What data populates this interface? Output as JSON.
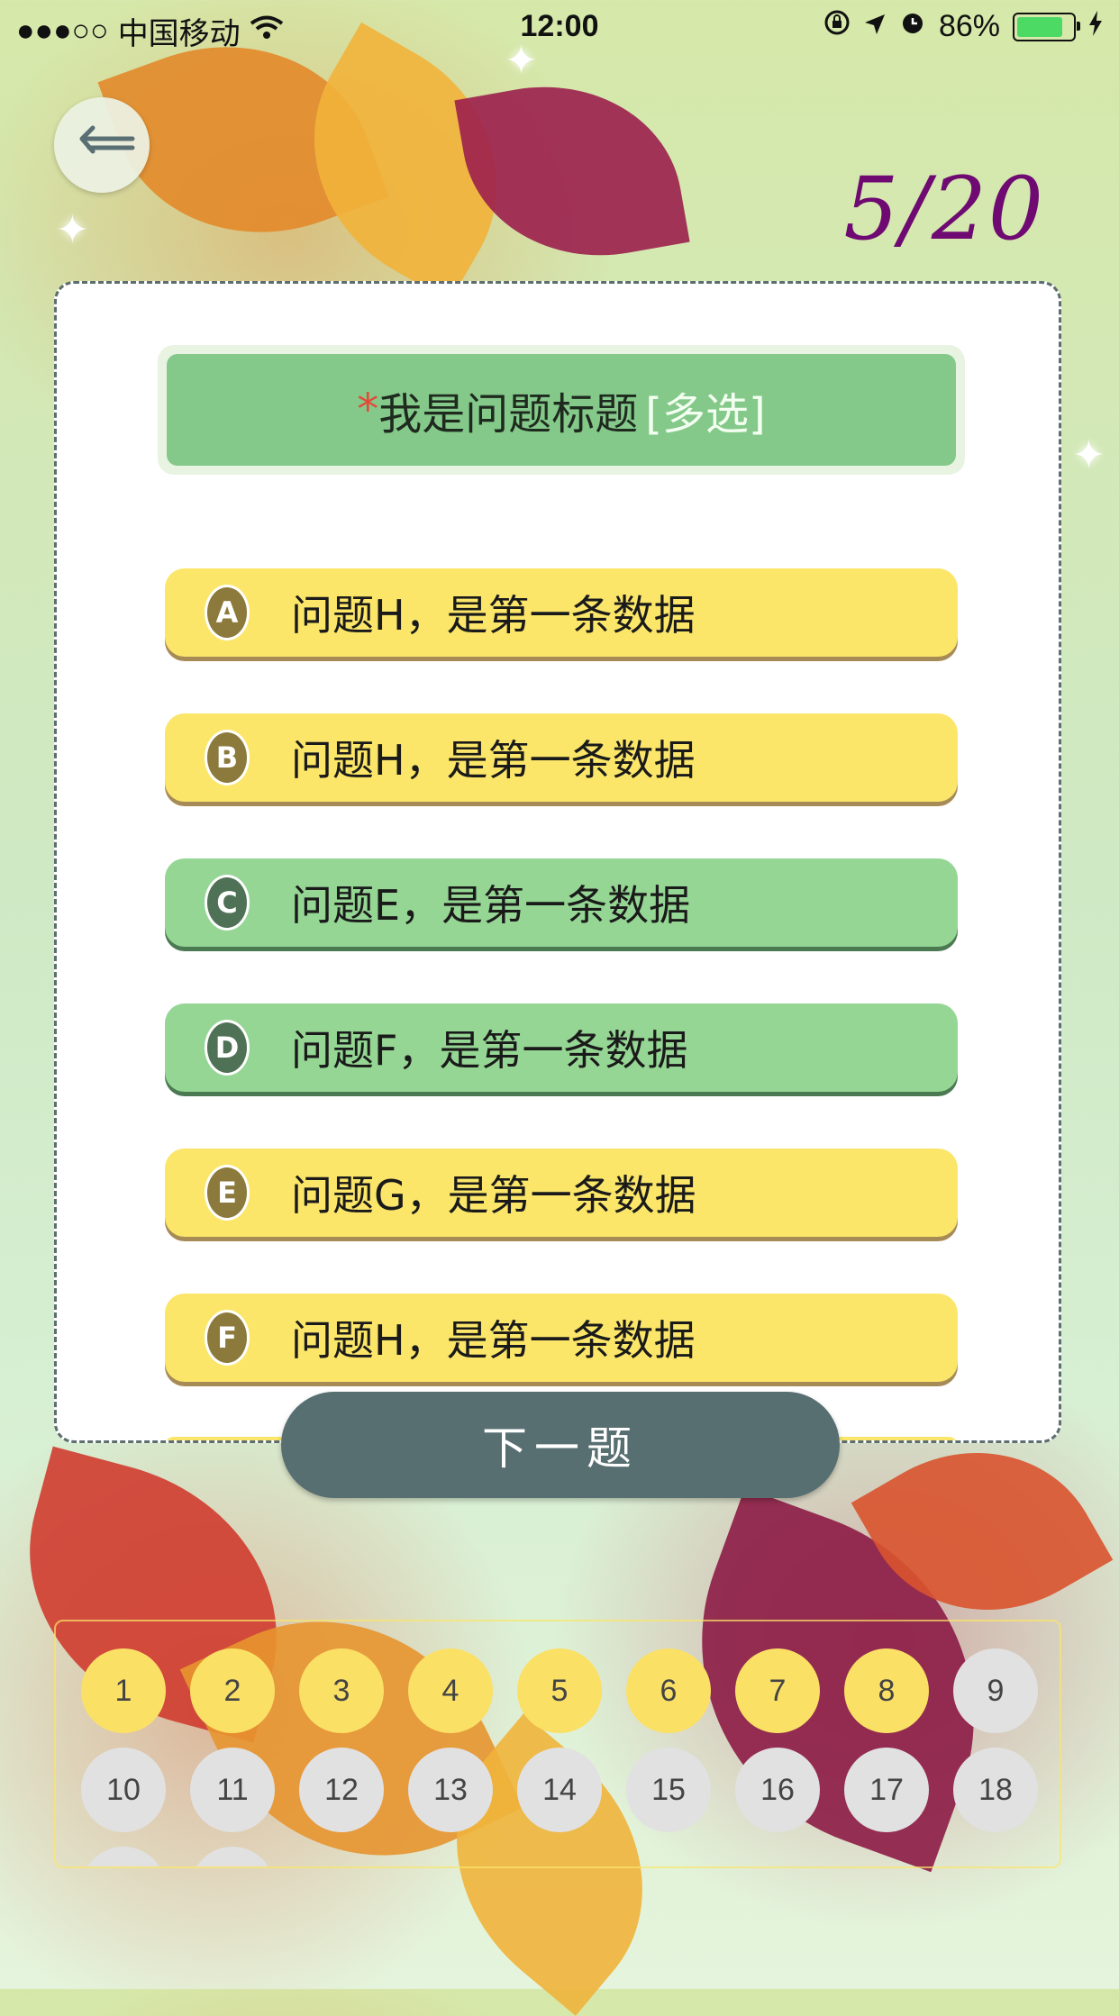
{
  "status_bar": {
    "signal": "●●●○○",
    "carrier": "中国移动",
    "wifi": "WiFi",
    "time": "12:00",
    "battery_text": "86%",
    "battery_level": 0.86
  },
  "header": {
    "progress": "5/20"
  },
  "question": {
    "required_mark": "*",
    "title": "我是问题标题",
    "type_tag": "[多选]"
  },
  "options": [
    {
      "letter": "A",
      "text": "问题H，是第一条数据",
      "state": "yellow"
    },
    {
      "letter": "B",
      "text": "问题H，是第一条数据",
      "state": "yellow"
    },
    {
      "letter": "C",
      "text": "问题E，是第一条数据",
      "state": "green"
    },
    {
      "letter": "D",
      "text": "问题F，是第一条数据",
      "state": "green"
    },
    {
      "letter": "E",
      "text": "问题G，是第一条数据",
      "state": "yellow"
    },
    {
      "letter": "F",
      "text": "问题H，是第一条数据",
      "state": "yellow"
    }
  ],
  "next_button": "下一题",
  "numbers": [
    {
      "label": "1",
      "answered": true
    },
    {
      "label": "2",
      "answered": true
    },
    {
      "label": "3",
      "answered": true
    },
    {
      "label": "4",
      "answered": true
    },
    {
      "label": "5",
      "answered": true
    },
    {
      "label": "6",
      "answered": true
    },
    {
      "label": "7",
      "answered": true
    },
    {
      "label": "8",
      "answered": true
    },
    {
      "label": "9",
      "answered": false
    },
    {
      "label": "10",
      "answered": false
    },
    {
      "label": "11",
      "answered": false
    },
    {
      "label": "12",
      "answered": false
    },
    {
      "label": "13",
      "answered": false
    },
    {
      "label": "14",
      "answered": false
    },
    {
      "label": "15",
      "answered": false
    },
    {
      "label": "16",
      "answered": false
    },
    {
      "label": "17",
      "answered": false
    },
    {
      "label": "18",
      "answered": false
    }
  ],
  "colors": {
    "answered": "#fbe066",
    "unanswered": "#e1e1e1",
    "option_yellow": "#fbe66a",
    "option_green": "#95d694",
    "next_button": "#586f72",
    "progress": "#6e0a72"
  }
}
